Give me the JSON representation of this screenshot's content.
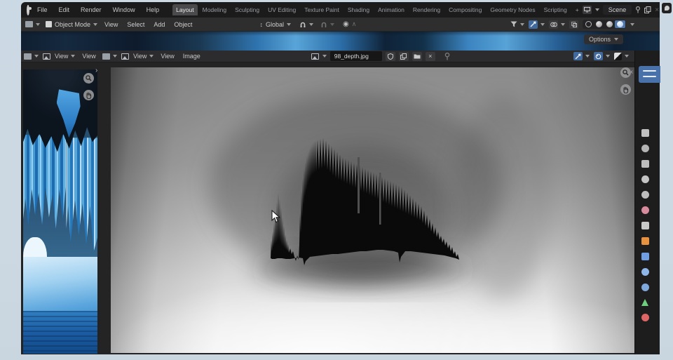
{
  "topbar": {
    "menus": [
      "File",
      "Edit",
      "Render",
      "Window",
      "Help"
    ],
    "workspaces": [
      {
        "label": "Layout",
        "active": true
      },
      {
        "label": "Modeling"
      },
      {
        "label": "Sculpting"
      },
      {
        "label": "UV Editing"
      },
      {
        "label": "Texture Paint"
      },
      {
        "label": "Shading"
      },
      {
        "label": "Animation"
      },
      {
        "label": "Rendering"
      },
      {
        "label": "Compositing"
      },
      {
        "label": "Geometry Nodes"
      },
      {
        "label": "Scripting"
      },
      {
        "label": "+"
      }
    ],
    "scene_name": "Scene"
  },
  "viewport": {
    "mode": "Object Mode",
    "menus": [
      "View",
      "Select",
      "Add",
      "Object"
    ],
    "orientation": "Global",
    "options_label": "Options"
  },
  "left_image_editor": {
    "mode": "View",
    "menus": [
      "View"
    ]
  },
  "image_editor": {
    "mode": "View",
    "menus": [
      "View",
      "Image"
    ],
    "image_name": "98_depth.jpg"
  },
  "icons": {
    "close": "×",
    "chevron_left": "‹",
    "chevron_right": "›",
    "proportional": "◉",
    "falloff": "∧",
    "orientation": "↕"
  },
  "properties_tabs": [
    {
      "name": "tool",
      "color": "#c2c2c2",
      "shape": "square"
    },
    {
      "name": "render",
      "color": "#b5b5b5",
      "shape": "circle"
    },
    {
      "name": "output",
      "color": "#bdbdbd",
      "shape": "square"
    },
    {
      "name": "view-layer",
      "color": "#c4c4c4",
      "shape": "circle"
    },
    {
      "name": "scene",
      "color": "#bdbdbd",
      "shape": "circle"
    },
    {
      "name": "world",
      "color": "#d98b9e",
      "shape": "circle"
    },
    {
      "name": "collection",
      "color": "#c9c9c9",
      "shape": "square"
    },
    {
      "name": "object",
      "color": "#e8913f",
      "shape": "square"
    },
    {
      "name": "modifiers",
      "color": "#6f9fe0",
      "shape": "square"
    },
    {
      "name": "particles",
      "color": "#8fb6e8",
      "shape": "circle"
    },
    {
      "name": "physics",
      "color": "#7fa8dd",
      "shape": "circle"
    },
    {
      "name": "object-data",
      "color": "#6fcf7f",
      "shape": "triangle"
    },
    {
      "name": "material",
      "color": "#e06666",
      "shape": "circle"
    }
  ],
  "colors": {
    "accent": "#4772b3",
    "header": "#2c2c2e",
    "desktop": "#ccd9e3",
    "editor_bg": "#242424"
  }
}
